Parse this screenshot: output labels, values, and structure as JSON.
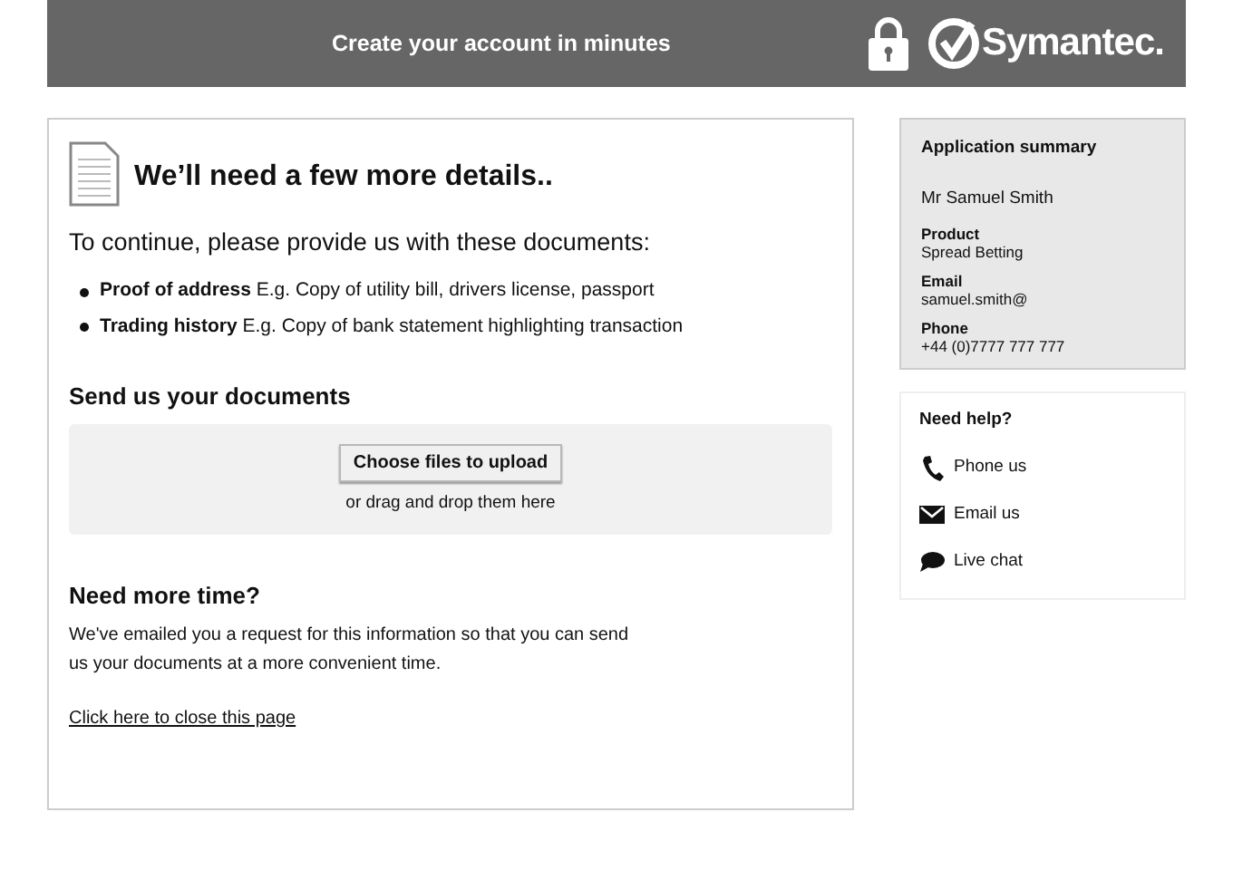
{
  "header": {
    "title": "Create your account in minutes",
    "logo": "Symantec."
  },
  "main": {
    "heading": "We’ll need a few more details..",
    "intro": "To continue, please provide us with these documents:",
    "documents": [
      "**Proof of address** E.g. Copy of utility bill, drivers license, passport",
      "**Trading history** E.g. Copy of bank statement highlighting transaction"
    ],
    "upload": {
      "heading": "Send us your documents",
      "button": "Choose files to upload",
      "hint": "or drag and drop them here"
    },
    "more_time": {
      "heading": "Need more time?",
      "text": "We've emailed you a request for this information so that you can send us your documents at a more convenient time.",
      "link": "Click here to close this page"
    }
  },
  "summary": {
    "title": "Application summary",
    "name": "Mr Samuel Smith",
    "fields": [
      {
        "label": "Product",
        "value": "Spread Betting"
      },
      {
        "label": "Email",
        "value": "samuel.smith@"
      },
      {
        "label": "Phone",
        "value": "+44 (0)7777 777 777"
      }
    ]
  },
  "help": {
    "title": "Need help?",
    "items": [
      {
        "kind": "phone",
        "label": "Phone us"
      },
      {
        "kind": "email",
        "label": "Email us"
      },
      {
        "kind": "chat",
        "label": "Live chat"
      }
    ]
  }
}
